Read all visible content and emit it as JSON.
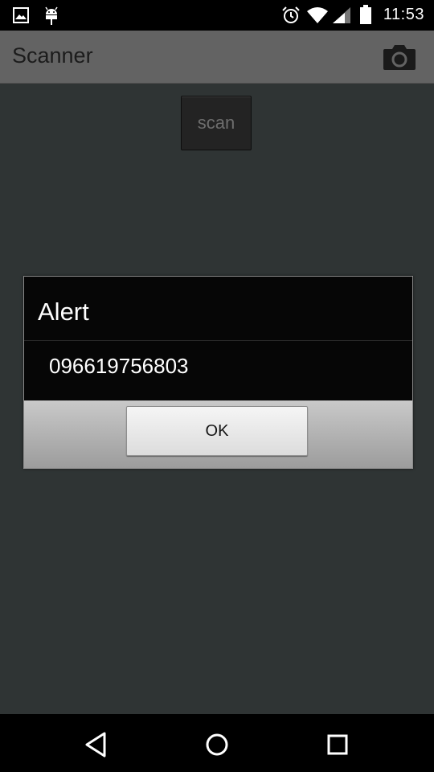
{
  "status_bar": {
    "time": "11:53",
    "icons": [
      "image-notification-icon",
      "android-debug-icon",
      "alarm-icon",
      "wifi-icon",
      "cell-signal-icon",
      "battery-icon"
    ]
  },
  "action_bar": {
    "title": "Scanner",
    "camera_icon": "camera-icon"
  },
  "content": {
    "scan_label": "scan"
  },
  "dialog": {
    "title": "Alert",
    "message": "096619756803",
    "ok_label": "OK"
  },
  "nav_bar": {
    "buttons": [
      "back-icon",
      "home-icon",
      "recents-icon"
    ]
  },
  "colors": {
    "background": "#2f3434",
    "action_bar": "#636363",
    "dialog": "#060606",
    "status_bar": "#000000"
  }
}
